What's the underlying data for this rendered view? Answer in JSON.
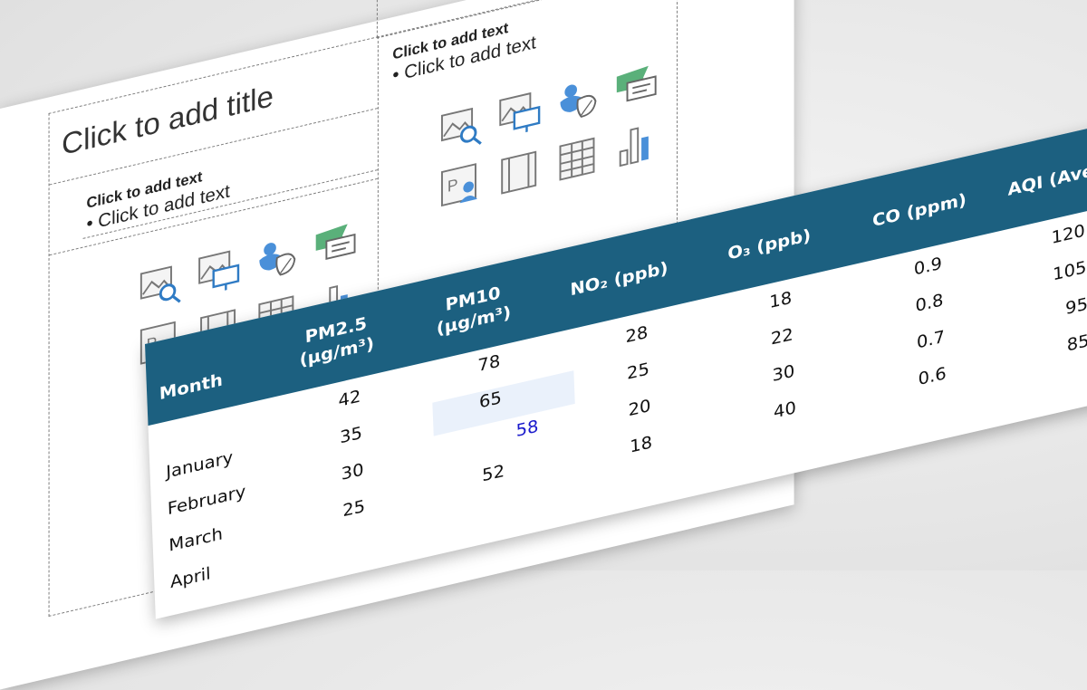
{
  "slide": {
    "title_placeholder": "Click to add title",
    "left_heading": "Click to add text",
    "left_bullet": "• Click to add text",
    "right_heading": "Click to add text",
    "right_bullet": "• Click to add text",
    "insert_icons": [
      "image-search-icon",
      "image-presentation-icon",
      "stock-duck-leaf-icon",
      "sensitivity-label-icon",
      "picture-profile-icon",
      "video-film-icon",
      "table-grid-icon",
      "chart-bar-icon"
    ]
  },
  "table": {
    "headers": {
      "month": "Month",
      "pm25_line1": "PM2.5",
      "pm25_line2": "(µg/m³)",
      "pm10_line1": "PM10",
      "pm10_line2": "(µg/m³)",
      "no2": "NO₂ (ppb)",
      "o3": "O₃ (ppb)",
      "co": "CO (ppm)",
      "aqi": "AQI (Ave"
    },
    "months": [
      "January",
      "February",
      "March",
      "April"
    ],
    "pm25": [
      "42",
      "35",
      "30",
      "25"
    ],
    "pm10": [
      "78",
      "65",
      "58",
      "52"
    ],
    "no2": [
      "28",
      "25",
      "20",
      "18"
    ],
    "o3": [
      "18",
      "22",
      "30",
      "40"
    ],
    "co": [
      "0.9",
      "0.8",
      "0.7",
      "0.6"
    ],
    "aqi": [
      "120",
      "105",
      "95",
      "85"
    ],
    "selected_cell_value": "58",
    "selected_text_color": "#1a1acc",
    "header_color": "#1c6080"
  }
}
